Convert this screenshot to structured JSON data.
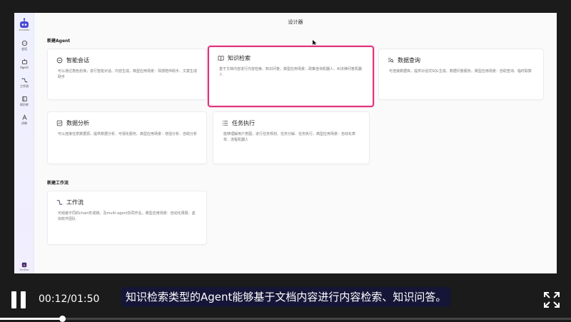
{
  "sidebar": {
    "logo_text": "SOCODEV",
    "items": [
      {
        "label": "会话",
        "icon": "chat-icon"
      },
      {
        "label": "Agent",
        "icon": "agent-icon"
      },
      {
        "label": "工作流",
        "icon": "workflow-icon"
      },
      {
        "label": "知识库",
        "icon": "book-icon"
      },
      {
        "label": "词典",
        "icon": "dictionary-icon"
      }
    ],
    "user_label": "YunXue"
  },
  "main": {
    "title": "设计器",
    "section_agent": "新建Agent",
    "section_workflow": "新建工作流",
    "agent_cards": [
      {
        "title": "智能会话",
        "desc": "可以通过角色扮演，进行智能对话、内容生成。典型应用场景：情感陪伴助手、文案生成助手",
        "icon": "chat-bubble-icon"
      },
      {
        "title": "知识检索",
        "desc": "基于文档内容进行内容检索、知识问答。典型应用场景：政策咨询机器人、AI法律问答机器人",
        "icon": "book-open-icon"
      },
      {
        "title": "数据查询",
        "desc": "可连接数据库，提供对话式SQL生成、数据问答服务。典型应用场景：自助查询、临时取数",
        "icon": "data-search-icon"
      },
      {
        "title": "数据分析",
        "desc": "可以连接任意数据源，提供数据分析、可视化服务。典型应用场景：增强分析、自助分析",
        "icon": "chart-icon"
      },
      {
        "title": "任务执行",
        "desc": "能够理解用户意图，进行任务规划、任务分解、任务执行。典型应用场景：自动化表单、流程机器人",
        "icon": "task-list-icon"
      }
    ],
    "workflow_cards": [
      {
        "title": "工作流",
        "desc": "可组装不同的chain形成链，及multi-agent协同作业。典型应用场景：自动化周报、虚拟软件团队",
        "icon": "workflow-icon"
      }
    ]
  },
  "player": {
    "time": "00:12/01:50",
    "subtitle": "知识检索类型的Agent能够基于文档内容进行内容检索、知识问答。",
    "progress": 0.109,
    "highlight_color": "#e0357c",
    "accent_color": "#5b5bd6"
  }
}
